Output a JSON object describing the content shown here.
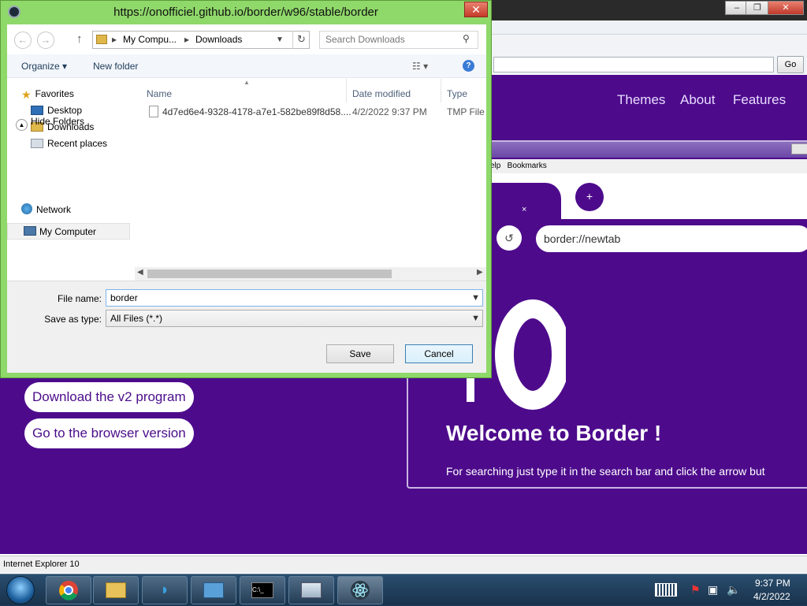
{
  "ie": {
    "go_label": "Go",
    "status_text": "Internet Explorer 10",
    "window_controls": {
      "minimize": "–",
      "restore": "❐",
      "close": "✕"
    }
  },
  "site": {
    "nav": [
      "Themes",
      "About",
      "Features"
    ],
    "buttons": {
      "download": "Download the v2 program",
      "browser": "Go to the browser version"
    },
    "inner": {
      "menu": "elp   Bookmarks",
      "tab_close": "×",
      "new_tab": "+",
      "reload": "↺",
      "url": "border://newtab",
      "welcome": "Welcome to Border !",
      "description": "For searching just type it in the search bar and click the arrow but"
    }
  },
  "dialog": {
    "title": "https://onofficiel.github.io/border/w96/stable/border",
    "close": "✕",
    "nav": {
      "back": "←",
      "forward": "→",
      "up": "↑",
      "refresh": "↻"
    },
    "breadcrumb": [
      "My Compu...",
      "Downloads"
    ],
    "search_placeholder": "Search Downloads",
    "toolbar": {
      "organize": "Organize ▾",
      "new_folder": "New folder",
      "view": "☷ ▾",
      "help": "?"
    },
    "tree": {
      "favorites": "Favorites",
      "desktop": "Desktop",
      "downloads": "Downloads",
      "recent": "Recent places",
      "my_computer": "My Computer",
      "network": "Network"
    },
    "columns": {
      "name": "Name",
      "date": "Date modified",
      "type": "Type"
    },
    "files": [
      {
        "name": "4d7ed6e4-9328-4178-a7e1-582be89f8d58....",
        "date": "4/2/2022 9:37 PM",
        "type": "TMP File"
      }
    ],
    "file_name_label": "File name:",
    "file_name_value": "border",
    "save_type_label": "Save as type:",
    "save_type_value": "All Files (*.*)",
    "hide_folders": "Hide Folders",
    "save": "Save",
    "cancel": "Cancel"
  },
  "taskbar": {
    "time": "9:37 PM",
    "date": "4/2/2022"
  }
}
